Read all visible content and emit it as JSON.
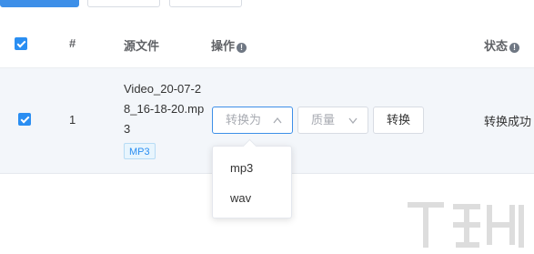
{
  "table": {
    "headers": {
      "index": "#",
      "source_file": "源文件",
      "operation": "操作",
      "status": "状态"
    },
    "row": {
      "index": "1",
      "filename": "Video_20-07-28_16-18-20.mp3",
      "format_badge": "MP3",
      "convert_placeholder": "转换为",
      "quality_placeholder": "质量",
      "convert_button": "转换",
      "status": "转换成功"
    }
  },
  "dropdown": {
    "options": [
      "mp3",
      "wav"
    ]
  },
  "colors": {
    "accent": "#2a8ef2",
    "row_bg": "#f3f6fa",
    "border": "#d8dce3"
  },
  "icons": {
    "info": "info-icon",
    "chevron_up": "chevron-up-icon",
    "chevron_down": "chevron-down-icon",
    "checkbox": "checkbox-checked-icon"
  }
}
